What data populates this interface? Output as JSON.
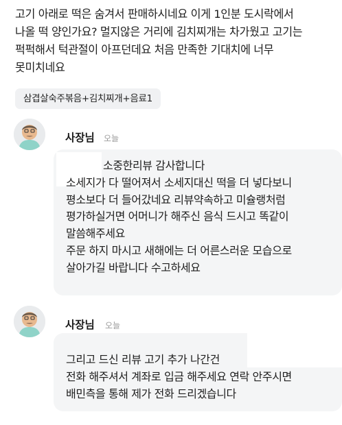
{
  "review": {
    "lines": [
      "고기 아래로 떡은 숨겨서 판매하시네요 이게 1인분 도시락에서",
      "나올 떡 양인가요? 멀지않은 거리에 김치찌개는 차가웠고 고기는",
      "퍽퍽해서 턱관절이 아프던데요 처음 만족한 기대치에 너무",
      "못미치네요"
    ],
    "menu_chip": "삼겹살숙주볶음+김치찌개+음료1"
  },
  "replies": [
    {
      "owner_name": "사장님",
      "time": "오늘",
      "lines": [
        "소중한리뷰 감사합니다",
        "소세지가 다 떨어져서 소세지대신 떡을 더 넣다보니",
        "평소보다 더  들어갔네요 리뷰약속하고 미슐랭처럼",
        "평가하실거면 어머니가 해주신 음식 드시고 똑같이",
        "말씀해주세요",
        "주문 하지 마시고 새해에는 더 어른스러운 모습으로",
        "살아가길 바랍니다 수고하세요"
      ]
    },
    {
      "owner_name": "사장님",
      "time": "오늘",
      "lines": [
        "그리고 드신 리뷰  고기 추가 나간건",
        "전화 해주셔서 계좌로 입금 해주세요 연락 안주시면",
        "배민측을 통해 제가 전화 드리겠습니다"
      ]
    }
  ],
  "colors": {
    "bubble_bg": "#f4f5f6",
    "chip_bg": "#f0f1f3",
    "time_gray": "#9a9a9a",
    "avatar_shirt": "#8fd3c8"
  }
}
